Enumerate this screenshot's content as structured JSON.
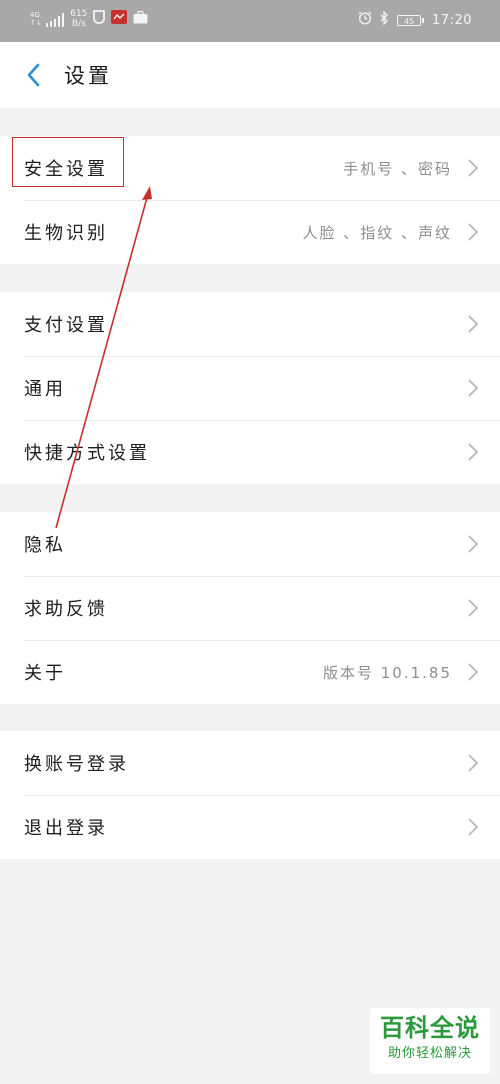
{
  "status_bar": {
    "network_type": "4G",
    "network_sub": "↑↓",
    "speed_value": "615",
    "speed_unit": "B/s",
    "battery_level": "45",
    "time": "17:20",
    "icons": [
      "signal-icon",
      "shield-app-icon",
      "red-app-icon",
      "briefcase-icon",
      "alarm-icon",
      "bluetooth-icon",
      "battery-icon"
    ]
  },
  "header": {
    "back_icon": "chevron-left-icon",
    "title": "设置"
  },
  "groups": [
    {
      "items": [
        {
          "label": "安全设置",
          "value": "手机号 、密码"
        },
        {
          "label": "生物识别",
          "value": "人脸 、指纹 、声纹"
        }
      ]
    },
    {
      "items": [
        {
          "label": "支付设置",
          "value": ""
        },
        {
          "label": "通用",
          "value": ""
        },
        {
          "label": "快捷方式设置",
          "value": ""
        }
      ]
    },
    {
      "items": [
        {
          "label": "隐私",
          "value": ""
        },
        {
          "label": "求助反馈",
          "value": ""
        },
        {
          "label": "关于",
          "value": "版本号 10.1.85"
        }
      ]
    },
    {
      "items": [
        {
          "label": "换账号登录",
          "value": ""
        },
        {
          "label": "退出登录",
          "value": ""
        }
      ]
    }
  ],
  "annotation": {
    "color": "#c8302e"
  },
  "watermark": {
    "main": "百科全说",
    "sub": "助你轻松解决"
  },
  "colors": {
    "accent": "#2a8fd6",
    "status_bar_bg": "#a8a8a8",
    "page_bg": "#f3f3f3",
    "watermark": "#2b9a3c"
  }
}
